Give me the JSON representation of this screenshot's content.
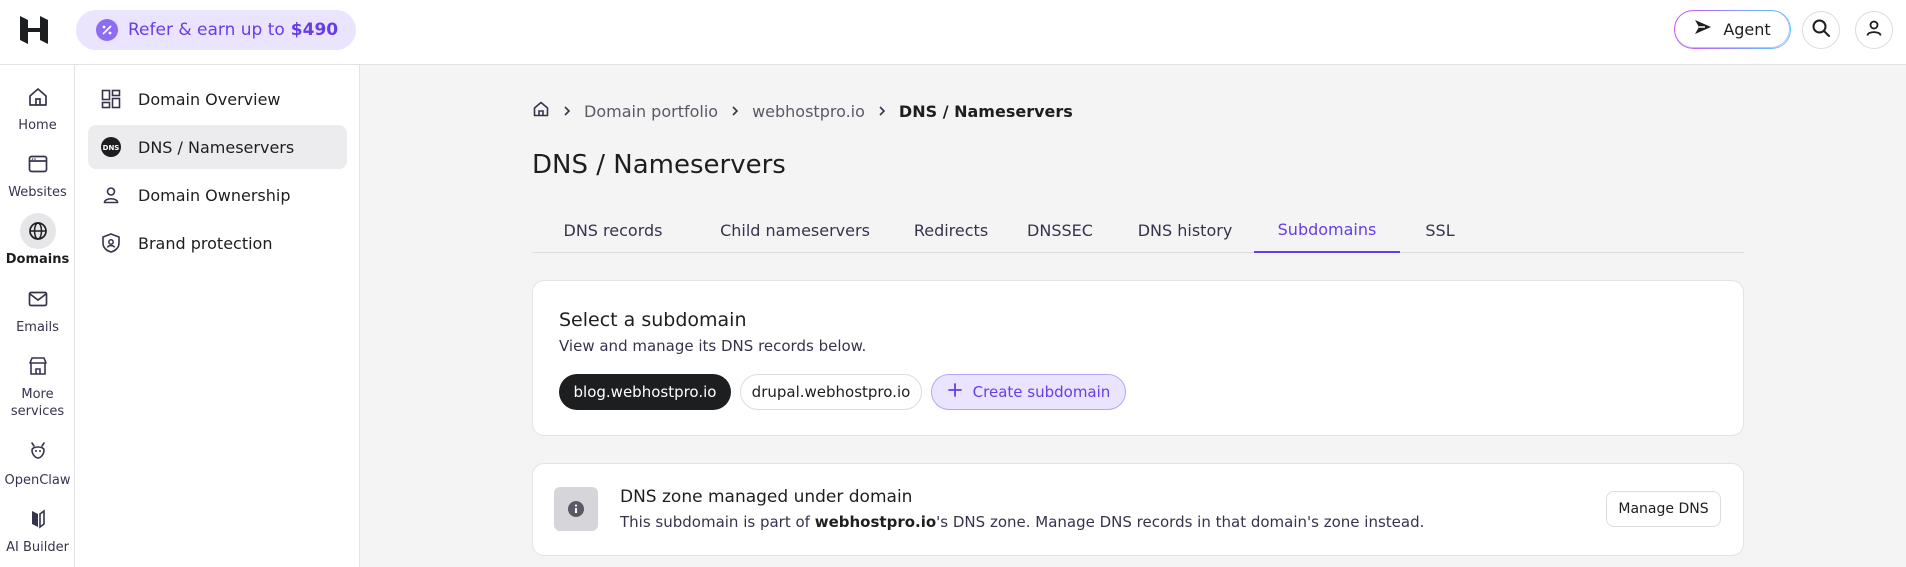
{
  "topbar": {
    "refer_text": "Refer & earn up to",
    "refer_amount": "$490",
    "agent_label": "Agent"
  },
  "rail": [
    {
      "label": "Home",
      "icon": "home-icon"
    },
    {
      "label": "Websites",
      "icon": "browser-window-icon"
    },
    {
      "label": "Domains",
      "icon": "globe-icon",
      "active": true
    },
    {
      "label": "Emails",
      "icon": "mail-icon"
    },
    {
      "label": "More services",
      "icon": "store-icon"
    },
    {
      "label": "OpenClaw",
      "icon": "claw-icon"
    },
    {
      "label": "AI Builder",
      "icon": "ai-builder-icon"
    }
  ],
  "side": [
    {
      "label": "Domain Overview",
      "icon": "dashboard-icon"
    },
    {
      "label": "DNS / Nameservers",
      "icon": "dns-icon",
      "active": true
    },
    {
      "label": "Domain Ownership",
      "icon": "person-icon"
    },
    {
      "label": "Brand protection",
      "icon": "shield-icon"
    }
  ],
  "breadcrumb": {
    "home_icon": "home-icon",
    "items": [
      "Domain portfolio",
      "webhostpro.io",
      "DNS / Nameservers"
    ]
  },
  "page_title": "DNS / Nameservers",
  "tabs": [
    "DNS records",
    "Child nameservers",
    "Redirects",
    "DNSSEC",
    "DNS history",
    "Subdomains",
    "SSL"
  ],
  "active_tab": "Subdomains",
  "subdomain_card": {
    "title": "Select a subdomain",
    "subtitle": "View and manage its DNS records below.",
    "selected": "blog.webhostpro.io",
    "other": "drupal.webhostpro.io",
    "create_label": "Create subdomain"
  },
  "zone_card": {
    "title": "DNS zone managed under domain",
    "text_before": "This subdomain is part of",
    "domain": "webhostpro.io",
    "text_after": "'s DNS zone. Manage DNS records in that domain's zone instead.",
    "button": "Manage DNS"
  },
  "colors": {
    "accent": "#673de6",
    "accent_light": "#ebe4ff",
    "dark": "#1d1e20"
  }
}
